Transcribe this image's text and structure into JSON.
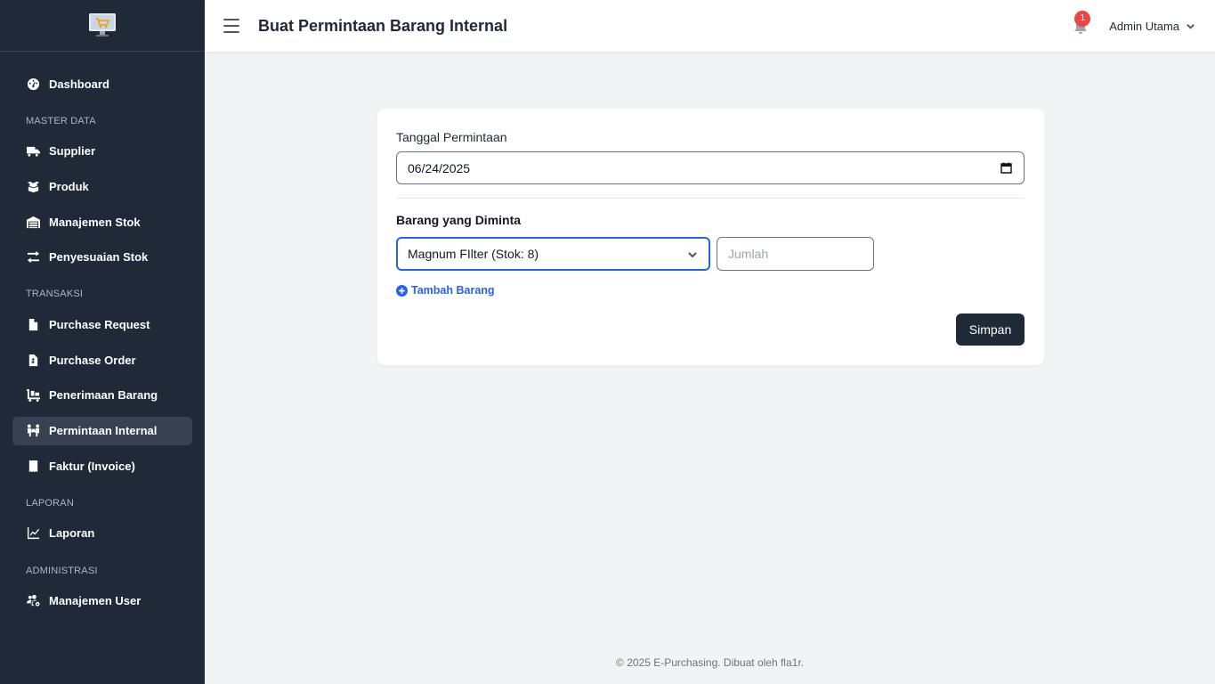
{
  "sidebar": {
    "logo_icon": "shopping-cart-monitor-icon",
    "sections": [
      {
        "title": "",
        "items": [
          {
            "label": "Dashboard",
            "icon": "gauge-icon",
            "active": false
          }
        ]
      },
      {
        "title": "MASTER DATA",
        "items": [
          {
            "label": "Supplier",
            "icon": "truck-icon",
            "active": false
          },
          {
            "label": "Produk",
            "icon": "box-icon",
            "active": false
          },
          {
            "label": "Manajemen Stok",
            "icon": "warehouse-icon",
            "active": false
          },
          {
            "label": "Penyesuaian Stok",
            "icon": "arrows-exchange-icon",
            "active": false
          }
        ]
      },
      {
        "title": "TRANSAKSI",
        "items": [
          {
            "label": "Purchase Request",
            "icon": "file-icon",
            "active": false
          },
          {
            "label": "Purchase Order",
            "icon": "file-invoice-icon",
            "active": false
          },
          {
            "label": "Penerimaan Barang",
            "icon": "dolly-icon",
            "active": false
          },
          {
            "label": "Permintaan Internal",
            "icon": "people-carry-icon",
            "active": true
          },
          {
            "label": "Faktur (Invoice)",
            "icon": "receipt-icon",
            "active": false
          }
        ]
      },
      {
        "title": "LAPORAN",
        "items": [
          {
            "label": "Laporan",
            "icon": "chart-line-icon",
            "active": false
          }
        ]
      },
      {
        "title": "ADMINISTRASI",
        "items": [
          {
            "label": "Manajemen User",
            "icon": "users-cog-icon",
            "active": false
          }
        ]
      }
    ]
  },
  "header": {
    "title": "Buat Permintaan Barang Internal",
    "notification_count": "1",
    "user_name": "Admin Utama"
  },
  "form": {
    "date_label": "Tanggal Permintaan",
    "date_value": "06/24/2025",
    "items_label": "Barang yang Diminta",
    "selected_item": "Magnum FIlter (Stok: 8)",
    "qty_placeholder": "Jumlah",
    "add_item_label": "Tambah Barang",
    "save_label": "Simpan"
  },
  "footer": {
    "text": "© 2025 E-Purchasing. Dibuat oleh fla1r."
  },
  "colors": {
    "sidebar_bg": "#1f2937",
    "active_item_bg": "#374151",
    "accent": "#2563eb",
    "badge": "#ef4444",
    "page_bg": "#f2f3f5"
  }
}
